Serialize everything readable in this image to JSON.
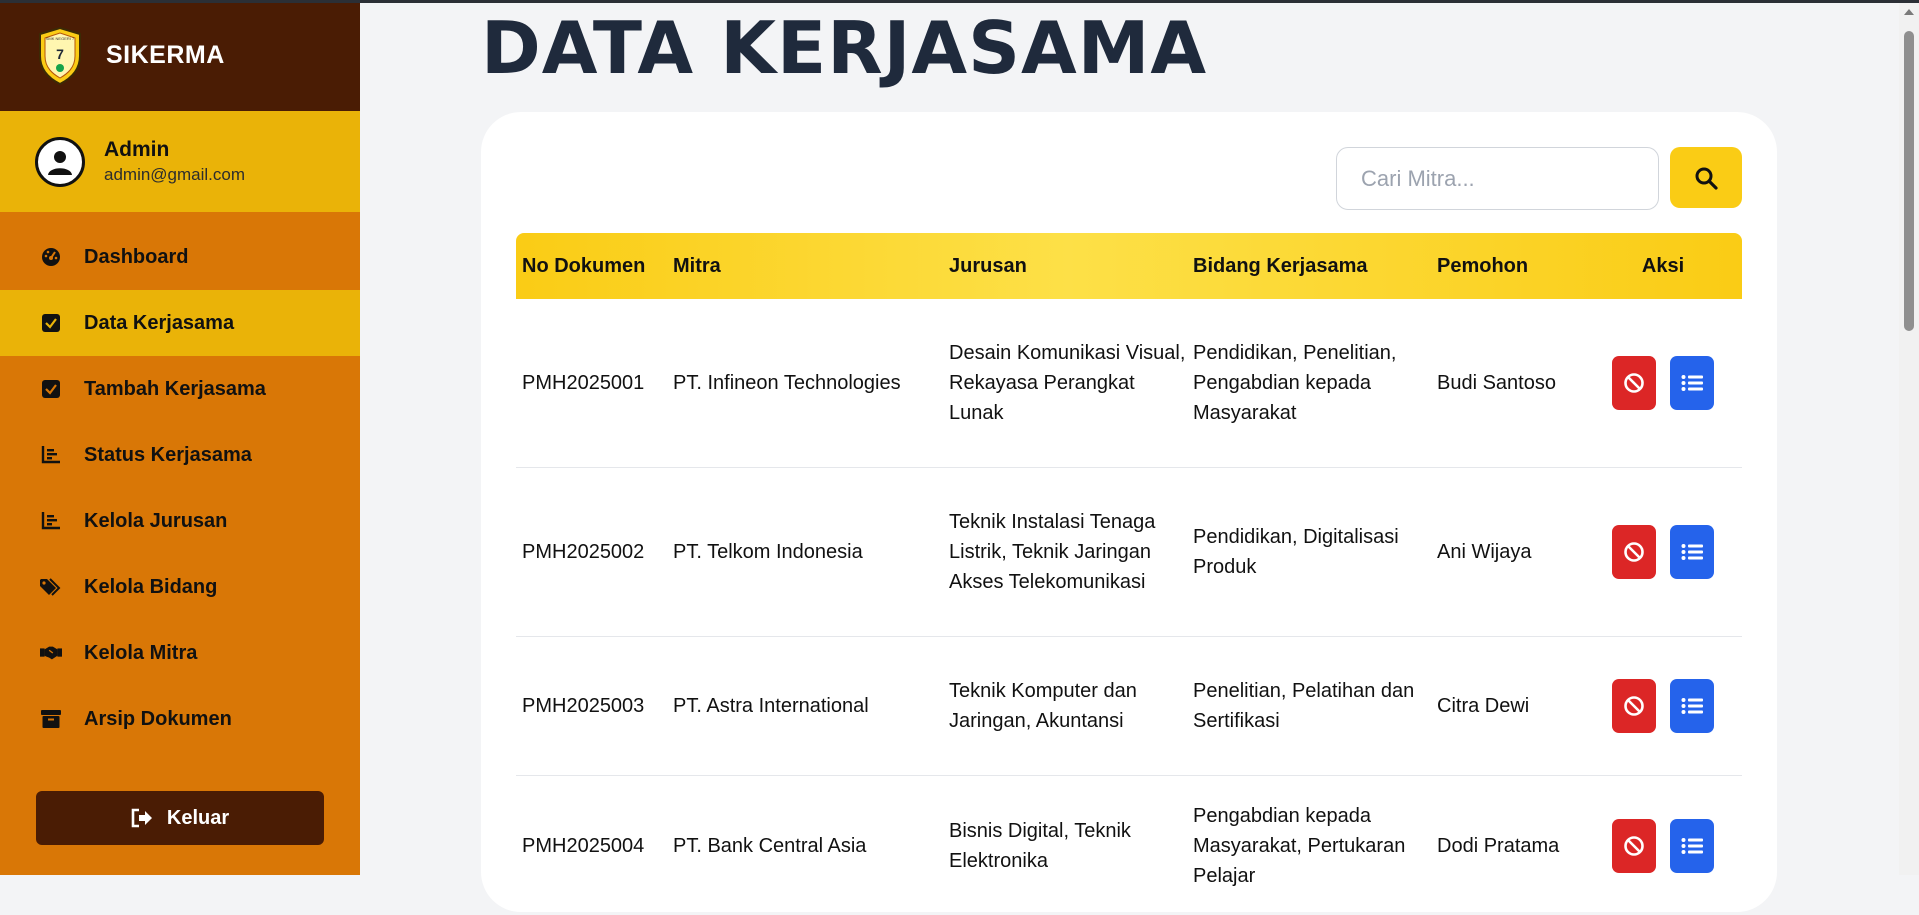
{
  "brand": {
    "name": "SIKERMA",
    "logo_icon": "school-shield-logo",
    "logo_text": "SMK NEGERI 7"
  },
  "user": {
    "name": "Admin",
    "email": "admin@gmail.com"
  },
  "sidebar": {
    "items": [
      {
        "label": "Dashboard",
        "icon": "dashboard-gauge-icon",
        "active": false
      },
      {
        "label": "Data Kerjasama",
        "icon": "checkbox-icon",
        "active": true
      },
      {
        "label": "Tambah Kerjasama",
        "icon": "checkbox-icon",
        "active": false
      },
      {
        "label": "Status Kerjasama",
        "icon": "bar-chart-icon",
        "active": false
      },
      {
        "label": "Kelola Jurusan",
        "icon": "bar-chart-icon",
        "active": false
      },
      {
        "label": "Kelola Bidang",
        "icon": "tags-icon",
        "active": false
      },
      {
        "label": "Kelola Mitra",
        "icon": "handshake-icon",
        "active": false
      },
      {
        "label": "Arsip Dokumen",
        "icon": "archive-box-icon",
        "active": false
      }
    ],
    "logout_label": "Keluar"
  },
  "page": {
    "title": "DATA KERJASAMA"
  },
  "search": {
    "placeholder": "Cari Mitra..."
  },
  "table": {
    "headers": [
      "No Dokumen",
      "Mitra",
      "Jurusan",
      "Bidang Kerjasama",
      "Pemohon",
      "Aksi"
    ],
    "rows": [
      {
        "no": "PMH2025001",
        "mitra": "PT. Infineon Technologies",
        "jurusan": "Desain Komunikasi Visual, Rekayasa Perangkat Lunak",
        "bidang": "Pendidikan, Penelitian, Pengabdian kepada Masyarakat",
        "pemohon": "Budi Santoso"
      },
      {
        "no": "PMH2025002",
        "mitra": "PT. Telkom Indonesia",
        "jurusan": "Teknik Instalasi Tenaga Listrik, Teknik Jaringan Akses Telekomunikasi",
        "bidang": "Pendidikan, Digitalisasi Produk",
        "pemohon": "Ani Wijaya"
      },
      {
        "no": "PMH2025003",
        "mitra": "PT. Astra International",
        "jurusan": "Teknik Komputer dan Jaringan, Akuntansi",
        "bidang": "Penelitian, Pelatihan dan Sertifikasi",
        "pemohon": "Citra Dewi"
      },
      {
        "no": "PMH2025004",
        "mitra": "PT. Bank Central Asia",
        "jurusan": "Bisnis Digital, Teknik Elektronika",
        "bidang": "Pengabdian kepada Masyarakat, Pertukaran Pelajar",
        "pemohon": "Dodi Pratama"
      }
    ]
  },
  "colors": {
    "sidebar": "#d97706",
    "brand_bg": "#4a1c04",
    "active": "#eab308",
    "header_yellow": "#facc15",
    "danger": "#dc2626",
    "primary": "#2563eb",
    "title": "#1f2a3c"
  }
}
